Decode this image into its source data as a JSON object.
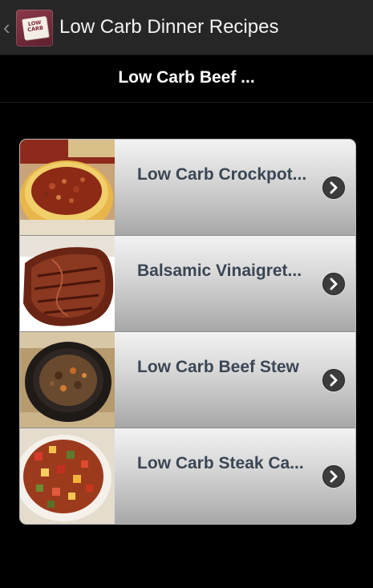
{
  "action_bar": {
    "title": "Low Carb Dinner Recipes",
    "app_icon_text": "LOW CARB"
  },
  "sub_header": {
    "title": "Low Carb Beef ..."
  },
  "recipes": [
    {
      "label": "Low Carb Crockpot..."
    },
    {
      "label": "Balsamic Vinaigret..."
    },
    {
      "label": "Low Carb Beef Stew"
    },
    {
      "label": "Low Carb Steak Ca..."
    }
  ],
  "icons": {
    "up": "chevron-left-icon",
    "row_action": "chevron-right-circle-icon"
  }
}
